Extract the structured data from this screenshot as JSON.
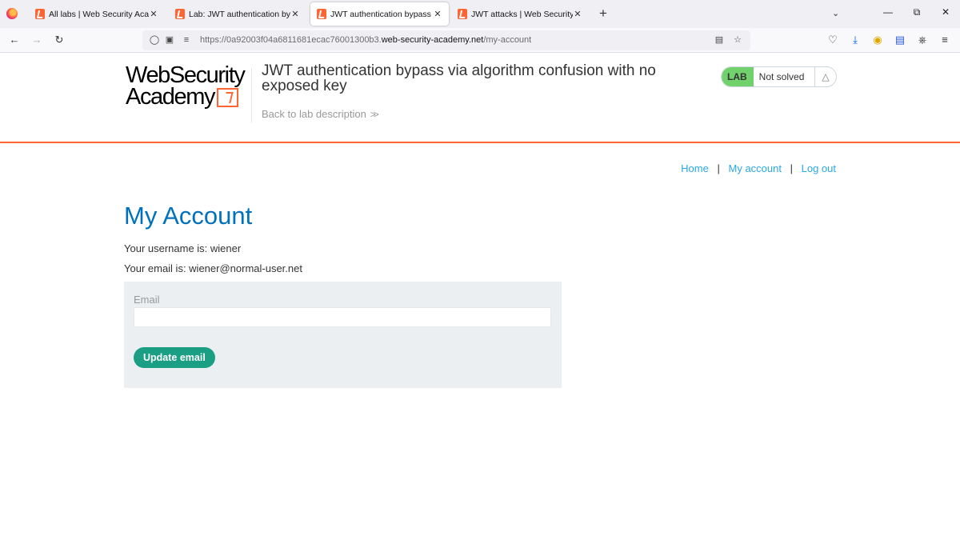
{
  "browser": {
    "tabs": [
      {
        "title": "All labs | Web Security Academy",
        "close": "✕"
      },
      {
        "title": "Lab: JWT authentication bypass via algorithm confusion",
        "close": "✕"
      },
      {
        "title": "JWT authentication bypass via algorithm confusion",
        "close": "✕"
      },
      {
        "title": "JWT attacks | Web Security Academy",
        "close": "✕"
      }
    ],
    "new_tab": "+",
    "url_prefix": "https://0a92003f04a6811681ecac76001300b3.",
    "url_domain": "web-security-academy.net",
    "url_path": "/my-account"
  },
  "header": {
    "logo_line1": "WebSecurity",
    "logo_line2": "Academy",
    "lab_title": "JWT authentication bypass via algorithm confusion with no exposed key",
    "back_link": "Back to lab description",
    "lab_badge": "LAB",
    "lab_status": "Not solved"
  },
  "nav": {
    "home": "Home",
    "my_account": "My account",
    "log_out": "Log out",
    "separator": "|"
  },
  "main": {
    "title": "My Account",
    "username_line": "Your username is: wiener",
    "email_line": "Your email is: wiener@normal-user.net",
    "form": {
      "email_label": "Email",
      "email_value": "",
      "submit_label": "Update email"
    }
  },
  "colors": {
    "accent_orange": "#ff6633",
    "title_blue": "#0071bc",
    "link_blue": "#29a8e0",
    "button_green": "#1a9e84",
    "lab_green": "#70d16d"
  }
}
